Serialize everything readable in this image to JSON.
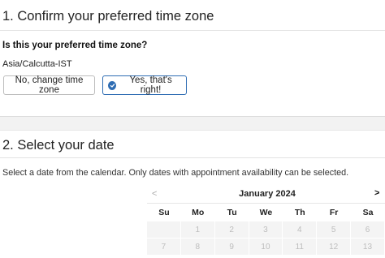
{
  "timezone_section": {
    "title": "1. Confirm your preferred time zone",
    "question": "Is this your preferred time zone?",
    "timezone": "Asia/Calcutta-IST",
    "btn_no": "No, change time zone",
    "btn_yes": "Yes, that's right!"
  },
  "date_section": {
    "title": "2. Select your date",
    "instructions": "Select a date from the calendar. Only dates with appointment availability can be selected."
  },
  "calendar": {
    "prev": "<",
    "next": ">",
    "month": "January 2024",
    "weekdays": [
      "Su",
      "Mo",
      "Tu",
      "We",
      "Th",
      "Fr",
      "Sa"
    ],
    "week1": [
      "",
      "1",
      "2",
      "3",
      "4",
      "5",
      "6"
    ],
    "week2": [
      "7",
      "8",
      "9",
      "10",
      "11",
      "12",
      "13"
    ]
  },
  "colors": {
    "accent": "#2f6db3",
    "disabled_cell": "#f4f4f4"
  }
}
